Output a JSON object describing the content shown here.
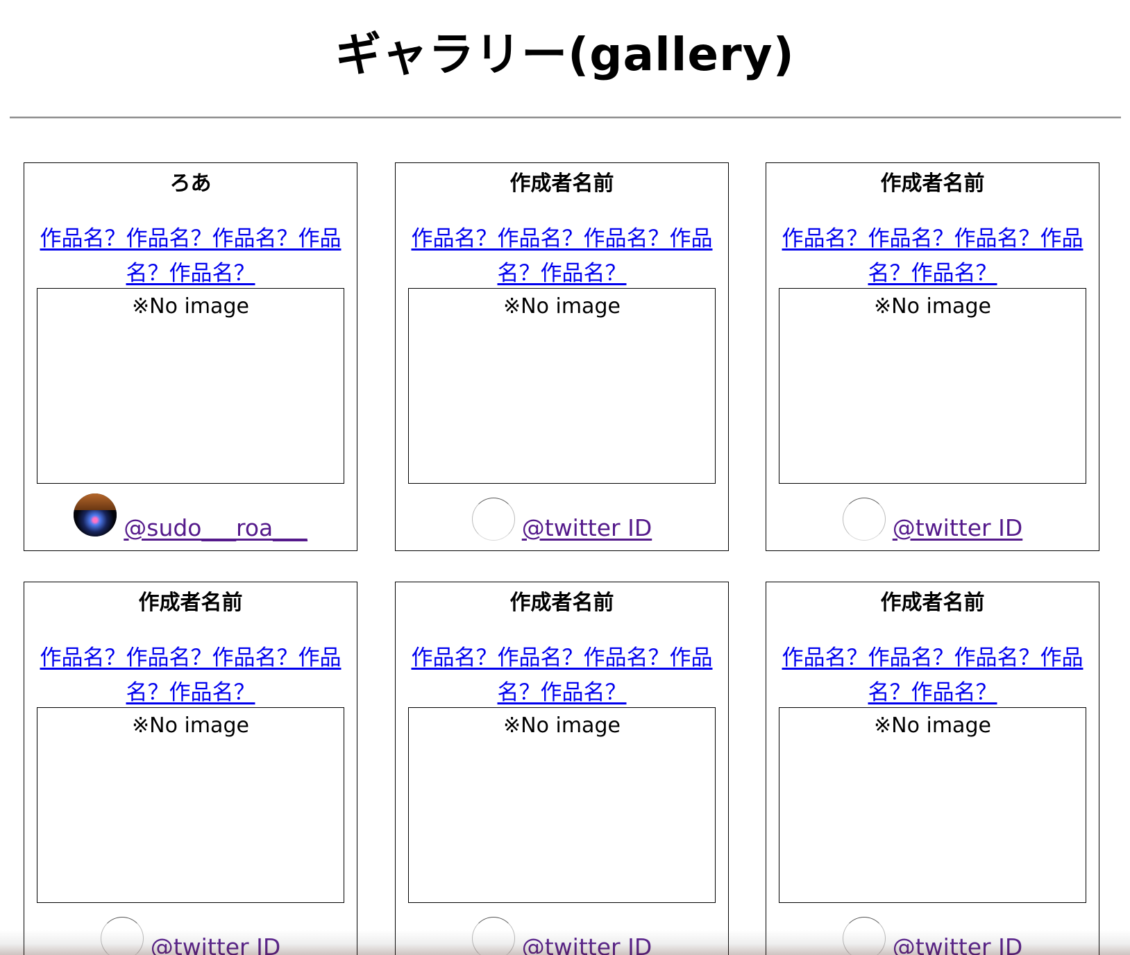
{
  "page": {
    "title": "ギャラリー(gallery)"
  },
  "cards": [
    {
      "author": "ろあ",
      "work_title": "作品名？作品名？作品名？作品名？作品名？",
      "no_image_text": "※No image",
      "avatar": "profile-photo",
      "handle": "@sudo___roa___"
    },
    {
      "author": "作成者名前",
      "work_title": "作品名？作品名？作品名？作品名？作品名？",
      "no_image_text": "※No image",
      "avatar": "empty",
      "handle": "@twitter ID"
    },
    {
      "author": "作成者名前",
      "work_title": "作品名？作品名？作品名？作品名？作品名？",
      "no_image_text": "※No image",
      "avatar": "empty",
      "handle": "@twitter ID"
    },
    {
      "author": "作成者名前",
      "work_title": "作品名？作品名？作品名？作品名？作品名？",
      "no_image_text": "※No image",
      "avatar": "empty",
      "handle": "@twitter ID"
    },
    {
      "author": "作成者名前",
      "work_title": "作品名？作品名？作品名？作品名？作品名？",
      "no_image_text": "※No image",
      "avatar": "empty",
      "handle": "@twitter ID"
    },
    {
      "author": "作成者名前",
      "work_title": "作品名？作品名？作品名？作品名？作品名？",
      "no_image_text": "※No image",
      "avatar": "empty",
      "handle": "@twitter ID"
    }
  ],
  "colors": {
    "link": "#0000ee",
    "visited_link": "#551a8b",
    "border": "#000000"
  }
}
